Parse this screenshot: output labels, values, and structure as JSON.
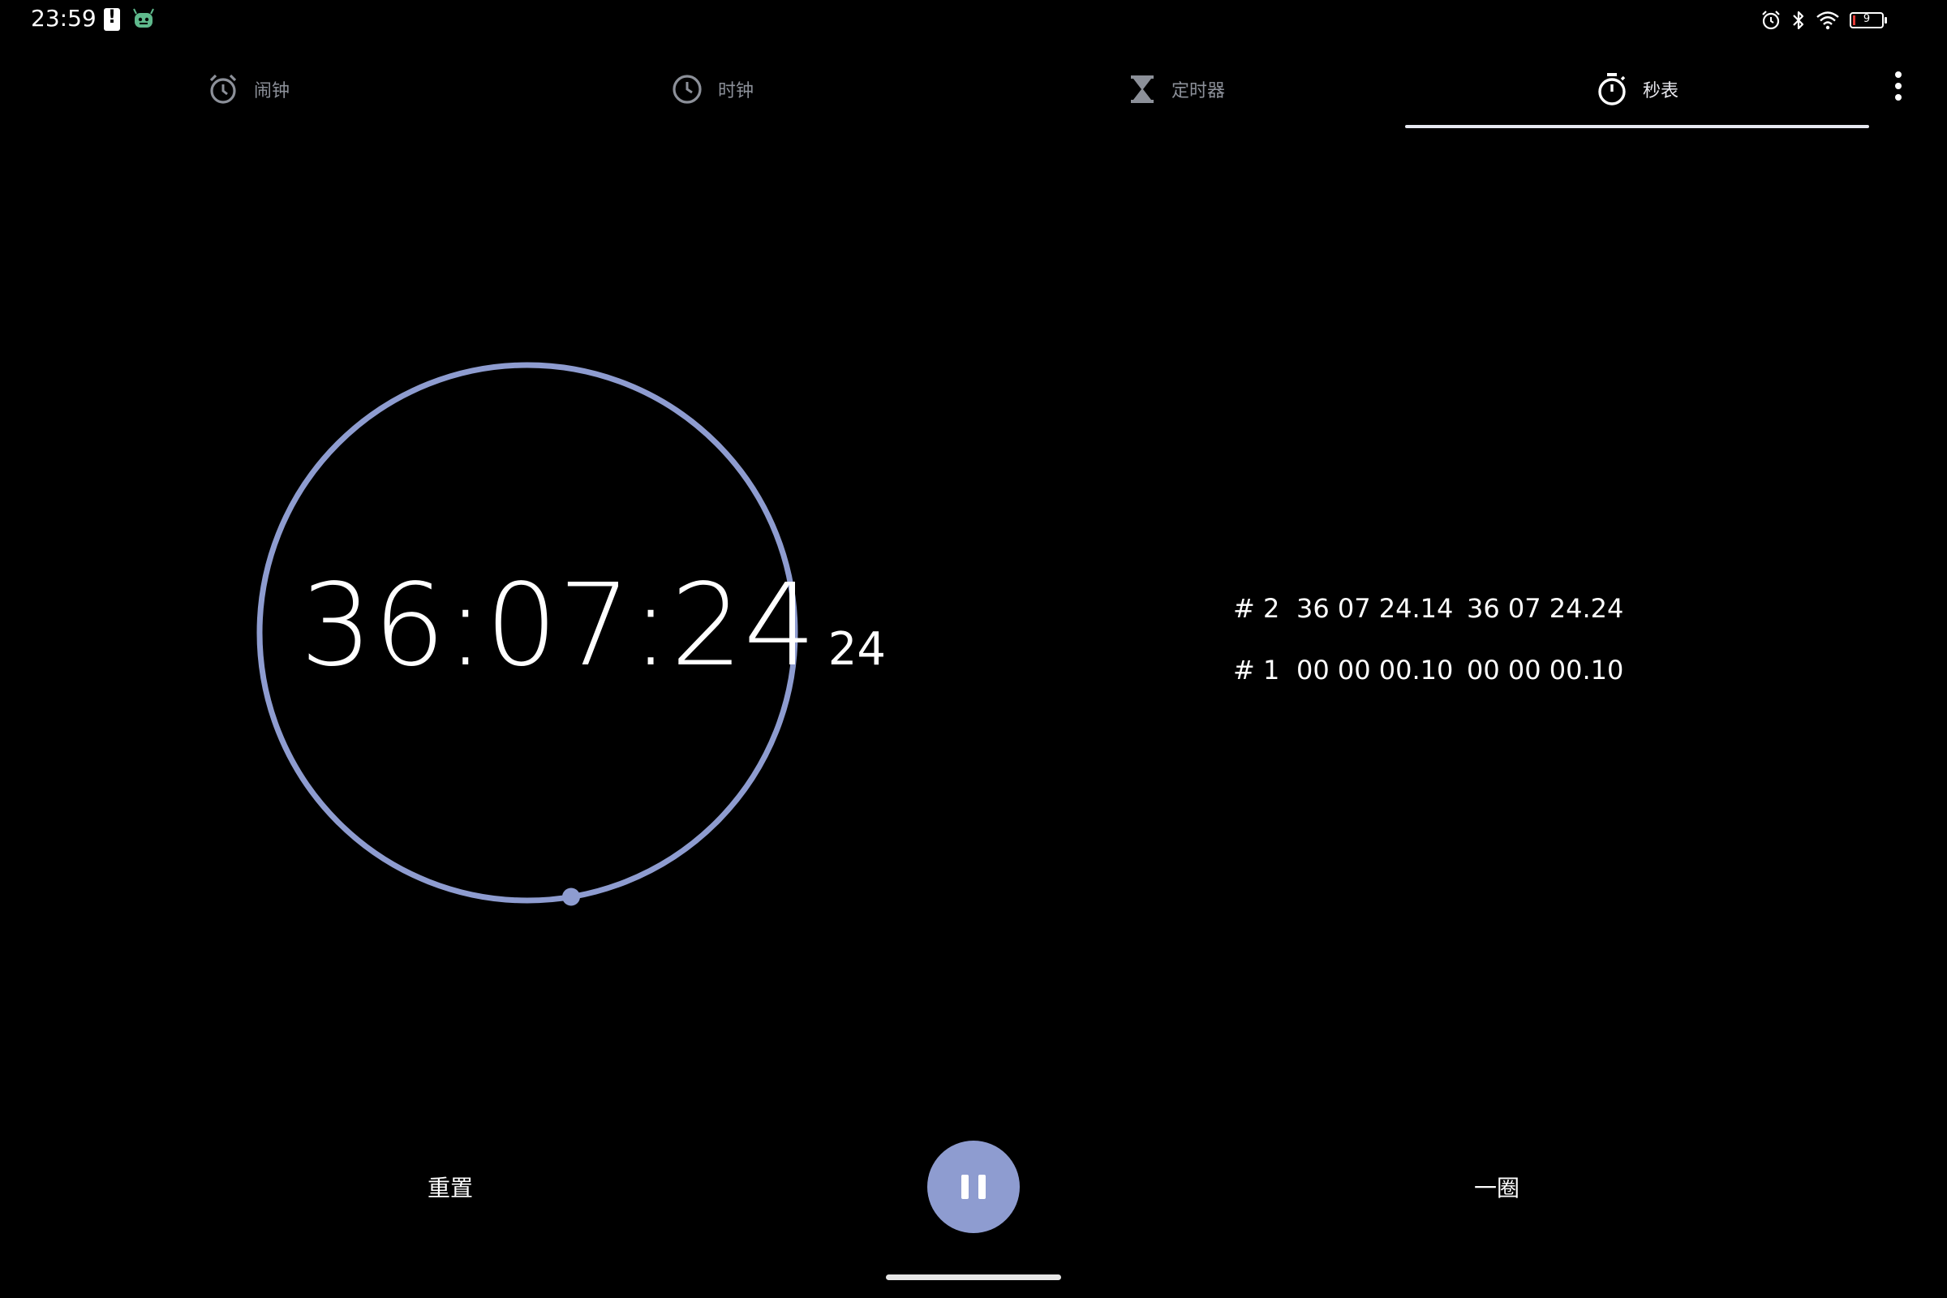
{
  "status_bar": {
    "time": "23:59",
    "battery_level": "9",
    "icons": [
      "battery-alert-icon",
      "robot-icon",
      "alarm-status-icon",
      "bluetooth-icon",
      "wifi-icon",
      "battery-icon"
    ]
  },
  "tabs": [
    {
      "label": "闹钟",
      "icon": "alarm-icon",
      "active": false
    },
    {
      "label": "时钟",
      "icon": "clock-icon",
      "active": false
    },
    {
      "label": "定时器",
      "icon": "hourglass-icon",
      "active": false
    },
    {
      "label": "秒表",
      "icon": "stopwatch-icon",
      "active": true
    }
  ],
  "stopwatch": {
    "time_main": "36:07:24",
    "time_hundredths": "24",
    "accent_color": "#8e9cd0"
  },
  "laps": [
    {
      "number": "# 2",
      "lap_time": "36 07 24.14",
      "total_time": "36 07 24.24"
    },
    {
      "number": "# 1",
      "lap_time": "00 00 00.10",
      "total_time": "00 00 00.10"
    }
  ],
  "controls": {
    "reset_label": "重置",
    "lap_label": "一圈",
    "pause_icon": "pause-icon"
  }
}
